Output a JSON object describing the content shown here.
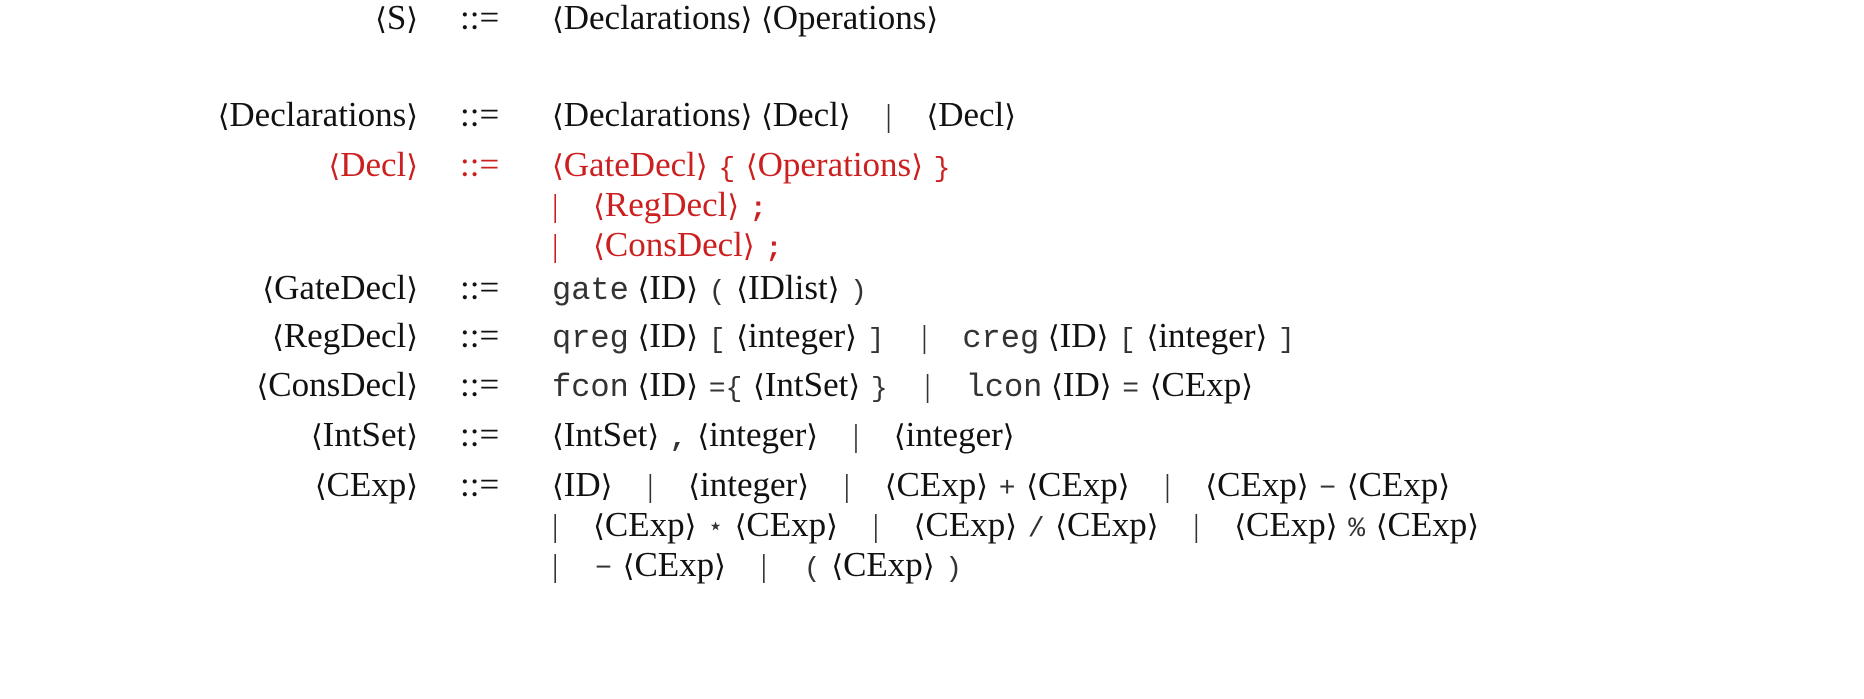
{
  "rules": [
    {
      "lhs": "S",
      "rhs": [
        [
          "nt",
          "Declarations"
        ],
        [
          "nt",
          "Operations"
        ]
      ]
    },
    {
      "lhs": "Declarations",
      "rhs": [
        [
          "nt",
          "Declarations"
        ],
        [
          "nt",
          "Decl"
        ],
        [
          "bar",
          "|"
        ],
        [
          "nt",
          "Decl"
        ]
      ]
    },
    {
      "lhs": "Decl",
      "highlight": true,
      "rhs": [
        [
          "nt",
          "GateDecl"
        ],
        [
          "sym",
          "{"
        ],
        [
          "nt",
          "Operations"
        ],
        [
          "sym",
          "}"
        ]
      ]
    },
    {
      "lhs": "",
      "highlight": true,
      "rhs": [
        [
          "barlead",
          "|"
        ],
        [
          "nt",
          "RegDecl"
        ],
        [
          "semi",
          ";"
        ]
      ]
    },
    {
      "lhs": "",
      "highlight": true,
      "rhs": [
        [
          "barlead",
          "|"
        ],
        [
          "nt",
          "ConsDecl"
        ],
        [
          "semi",
          ";"
        ]
      ]
    },
    {
      "lhs": "GateDecl",
      "rhs": [
        [
          "kw",
          "gate"
        ],
        [
          "nt",
          "ID"
        ],
        [
          "sym",
          "("
        ],
        [
          "nt",
          "IDlist"
        ],
        [
          "sym",
          ")"
        ]
      ]
    },
    {
      "lhs": "RegDecl",
      "rhs": [
        [
          "kw",
          "qreg"
        ],
        [
          "nt",
          "ID"
        ],
        [
          "sym",
          "["
        ],
        [
          "nt",
          "integer"
        ],
        [
          "sym",
          "]"
        ],
        [
          "bar",
          "|"
        ],
        [
          "kw",
          "creg"
        ],
        [
          "nt",
          "ID"
        ],
        [
          "sym",
          "["
        ],
        [
          "nt",
          "integer"
        ],
        [
          "sym",
          "]"
        ]
      ]
    },
    {
      "lhs": "ConsDecl",
      "rhs": [
        [
          "kw",
          "fcon"
        ],
        [
          "nt",
          "ID"
        ],
        [
          "sym",
          "={"
        ],
        [
          "nt",
          "IntSet"
        ],
        [
          "sym",
          "}"
        ],
        [
          "bar",
          "|"
        ],
        [
          "kw",
          "lcon"
        ],
        [
          "nt",
          "ID"
        ],
        [
          "sym",
          "="
        ],
        [
          "nt",
          "CExp"
        ]
      ]
    },
    {
      "lhs": "IntSet",
      "rhs": [
        [
          "nt",
          "IntSet"
        ],
        [
          "semi",
          ","
        ],
        [
          "nt",
          "integer"
        ],
        [
          "bar",
          "|"
        ],
        [
          "nt",
          "integer"
        ]
      ]
    },
    {
      "lhs": "CExp",
      "rhs": [
        [
          "nt",
          "ID"
        ],
        [
          "bar",
          "|"
        ],
        [
          "nt",
          "integer"
        ],
        [
          "bar",
          "|"
        ],
        [
          "nt",
          "CExp"
        ],
        [
          "sym",
          "+"
        ],
        [
          "nt",
          "CExp"
        ],
        [
          "bar",
          "|"
        ],
        [
          "nt",
          "CExp"
        ],
        [
          "sym",
          "−"
        ],
        [
          "nt",
          "CExp"
        ]
      ]
    },
    {
      "lhs": "",
      "rhs": [
        [
          "barlead",
          "|"
        ],
        [
          "nt",
          "CExp"
        ],
        [
          "sym",
          "⋆"
        ],
        [
          "nt",
          "CExp"
        ],
        [
          "bar",
          "|"
        ],
        [
          "nt",
          "CExp"
        ],
        [
          "sym",
          "/"
        ],
        [
          "nt",
          "CExp"
        ],
        [
          "bar",
          "|"
        ],
        [
          "nt",
          "CExp"
        ],
        [
          "sym",
          "%"
        ],
        [
          "nt",
          "CExp"
        ]
      ]
    },
    {
      "lhs": "",
      "rhs": [
        [
          "barlead",
          "|"
        ],
        [
          "sym",
          "−"
        ],
        [
          "nt",
          "CExp"
        ],
        [
          "bar",
          "|"
        ],
        [
          "sym",
          "("
        ],
        [
          "nt",
          "CExp"
        ],
        [
          "sym",
          ")"
        ]
      ]
    }
  ],
  "def_symbol": "::="
}
